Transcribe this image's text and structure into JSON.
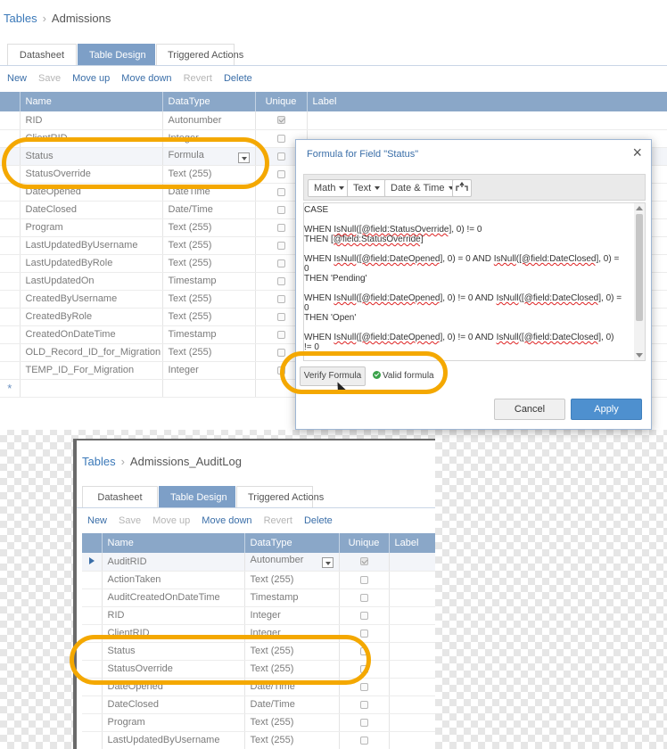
{
  "screen1": {
    "breadcrumb": {
      "root": "Tables",
      "current": "Admissions"
    },
    "tabs": [
      "Datasheet",
      "Table Design",
      "Triggered Actions"
    ],
    "toolbar": {
      "new": "New",
      "save": "Save",
      "move_up": "Move up",
      "move_down": "Move down",
      "revert": "Revert",
      "delete": "Delete"
    },
    "columns": {
      "name": "Name",
      "datatype": "DataType",
      "unique": "Unique",
      "label": "Label"
    },
    "rows": [
      {
        "name": "RID",
        "type": "Autonumber",
        "unique": true
      },
      {
        "name": "ClientRID",
        "type": "Integer",
        "unique": false
      },
      {
        "name": "Status",
        "type": "Formula",
        "unique": false
      },
      {
        "name": "StatusOverride",
        "type": "Text (255)",
        "unique": false
      },
      {
        "name": "DateOpened",
        "type": "DateTime",
        "unique": false
      },
      {
        "name": "DateClosed",
        "type": "Date/Time",
        "unique": false
      },
      {
        "name": "Program",
        "type": "Text (255)",
        "unique": false
      },
      {
        "name": "LastUpdatedByUsername",
        "type": "Text (255)",
        "unique": false
      },
      {
        "name": "LastUpdatedByRole",
        "type": "Text (255)",
        "unique": false
      },
      {
        "name": "LastUpdatedOn",
        "type": "Timestamp",
        "unique": false
      },
      {
        "name": "CreatedByUsername",
        "type": "Text (255)",
        "unique": false
      },
      {
        "name": "CreatedByRole",
        "type": "Text (255)",
        "unique": false
      },
      {
        "name": "CreatedOnDateTime",
        "type": "Timestamp",
        "unique": false
      },
      {
        "name": "OLD_Record_ID_for_Migration",
        "type": "Text (255)",
        "unique": false
      },
      {
        "name": "TEMP_ID_For_Migration",
        "type": "Integer",
        "unique": false
      }
    ],
    "new_row_marker": "*"
  },
  "dialog": {
    "title": "Formula for Field \"Status\"",
    "close": "×",
    "buttons": {
      "math": "Math",
      "text": "Text",
      "datetime": "Date & Time"
    },
    "formula_lines": [
      "CASE",
      "",
      "WHEN IsNull([@field:StatusOverride], 0) != 0",
      "THEN [@field:StatusOverride]",
      "",
      "WHEN IsNull([@field:DateOpened], 0) = 0 AND IsNull([@field:DateClosed], 0) =",
      "0",
      "THEN 'Pending'",
      "",
      "WHEN IsNull([@field:DateOpened], 0) != 0 AND IsNull([@field:DateClosed], 0) =",
      "0",
      "THEN 'Open'",
      "",
      "WHEN IsNull([@field:DateOpened], 0) != 0 AND IsNull([@field:DateClosed], 0)",
      "!= 0"
    ],
    "verify": "Verify Formula",
    "valid": "Valid formula",
    "cancel": "Cancel",
    "apply": "Apply"
  },
  "screen2": {
    "breadcrumb": {
      "root": "Tables",
      "current": "Admissions_AuditLog"
    },
    "tabs": [
      "Datasheet",
      "Table Design",
      "Triggered Actions"
    ],
    "toolbar": {
      "new": "New",
      "save": "Save",
      "move_up": "Move up",
      "move_down": "Move down",
      "revert": "Revert",
      "delete": "Delete"
    },
    "columns": {
      "name": "Name",
      "datatype": "DataType",
      "unique": "Unique",
      "label": "Label"
    },
    "rows": [
      {
        "name": "AuditRID",
        "type": "Autonumber",
        "unique": true
      },
      {
        "name": "ActionTaken",
        "type": "Text (255)",
        "unique": false
      },
      {
        "name": "AuditCreatedOnDateTime",
        "type": "Timestamp",
        "unique": false
      },
      {
        "name": "RID",
        "type": "Integer",
        "unique": false
      },
      {
        "name": "ClientRID",
        "type": "Integer",
        "unique": false
      },
      {
        "name": "Status",
        "type": "Text (255)",
        "unique": false
      },
      {
        "name": "StatusOverride",
        "type": "Text (255)",
        "unique": false
      },
      {
        "name": "DateOpened",
        "type": "Date/Time",
        "unique": false
      },
      {
        "name": "DateClosed",
        "type": "Date/Time",
        "unique": false
      },
      {
        "name": "Program",
        "type": "Text (255)",
        "unique": false
      },
      {
        "name": "LastUpdatedByUsername",
        "type": "Text (255)",
        "unique": false
      }
    ]
  },
  "colors": {
    "accent": "#3a78b8",
    "header": "#8aa7c8",
    "tab_active": "#7d9fc7",
    "highlight": "#f4a800",
    "apply": "#4e90cf"
  },
  "icons": {
    "close": "close-icon",
    "expand": "expand-icon",
    "valid": "check-circle-icon",
    "row_pointer": "row-pointer-icon"
  }
}
